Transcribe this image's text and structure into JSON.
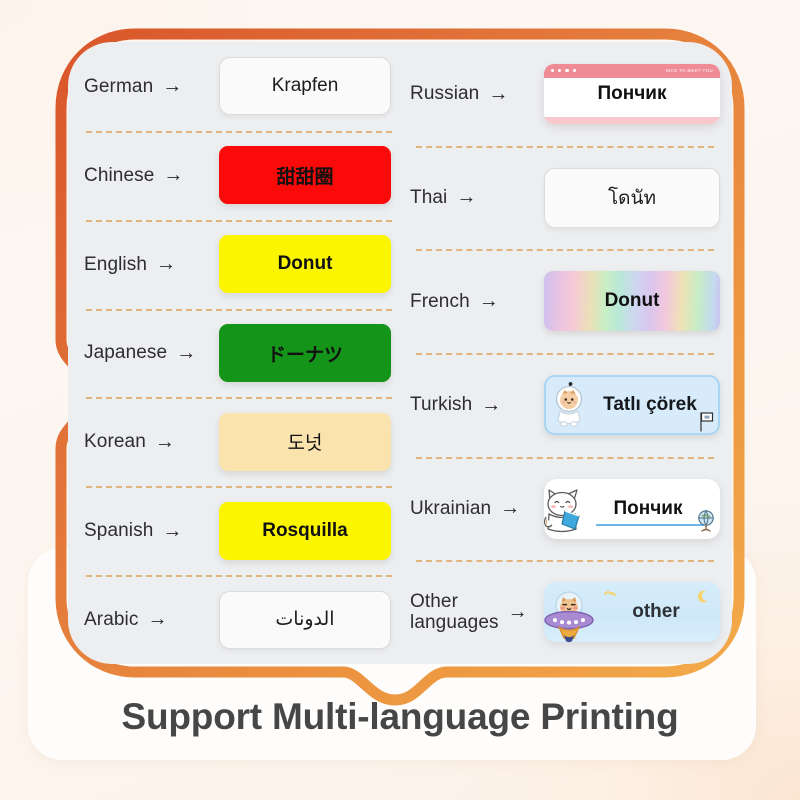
{
  "caption": "Support Multi-language Printing",
  "arrow_glyph": "→",
  "colors": {
    "frame_start": "#d9552a",
    "frame_end": "#f0a13f",
    "panel_bg": "#eceef0",
    "page_bg": "#fdf6f0",
    "divider": "#e0a96a",
    "red_label": "#fb0a0a",
    "yellow_label": "#fbf500",
    "green_label": "#15941a",
    "cream_label": "#fbe3ae",
    "blue_label": "#d7ebfa",
    "memo_header": "#ef8b95",
    "caption_text": "#464646"
  },
  "left_column": [
    {
      "language": "German",
      "word": "Krapfen",
      "style": "plain"
    },
    {
      "language": "Chinese",
      "word": "甜甜圈",
      "style": "red"
    },
    {
      "language": "English",
      "word": "Donut",
      "style": "yellow"
    },
    {
      "language": "Japanese",
      "word": "ドーナツ",
      "style": "green"
    },
    {
      "language": "Korean",
      "word": "도넛",
      "style": "cream"
    },
    {
      "language": "Spanish",
      "word": "Rosquilla",
      "style": "yellow"
    },
    {
      "language": "Arabic",
      "word": "الدونات",
      "style": "plain"
    }
  ],
  "right_column": [
    {
      "language": "Russian",
      "word": "Пончик",
      "style": "memo",
      "memo_tag": "NICE TO MEET YOU"
    },
    {
      "language": "Thai",
      "word": "โดนัท",
      "style": "plain"
    },
    {
      "language": "French",
      "word": "Donut",
      "style": "holo"
    },
    {
      "language": "Turkish",
      "word": "Tatlı çörek",
      "style": "blue",
      "art": "astronaut-kitten"
    },
    {
      "language": "Ukrainian",
      "word": "Пончик",
      "style": "white-pill",
      "art": "cat-with-book"
    },
    {
      "language": "Other\nlanguages",
      "word": "other",
      "style": "sky",
      "art": "ufo-cat"
    }
  ]
}
